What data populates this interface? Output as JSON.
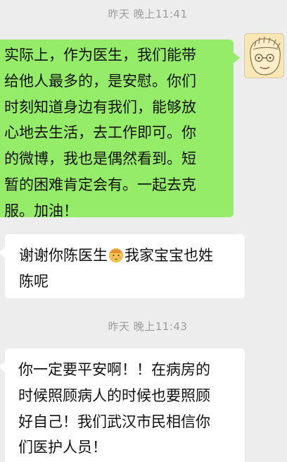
{
  "chat": {
    "timestamps": [
      "昨天 晚上11:41",
      "昨天 晚上11:43"
    ],
    "messages": [
      {
        "sender": "self",
        "lines": [
          "实际上，作为医生，我们能带",
          "给他人最多的，是安慰。你们",
          "时刻知道身边有我们，能够放",
          "心地去生活，去工作即可。你",
          "的微博，我也是偶然看到。短",
          "暂的困难肯定会有。一起去克",
          "服。加油！"
        ]
      },
      {
        "sender": "other",
        "line1_before_emoji": "谢谢你陈医生",
        "emoji": "shy-face-emoji",
        "line1_after_emoji": "我家宝宝也姓",
        "line2": "陈呢"
      },
      {
        "sender": "other",
        "lines": [
          "你一定要平安啊！！在病房的",
          "时候照顾病人的时候也要照顾",
          "好自己！我们武汉市民相信你",
          "们医护人员！"
        ]
      }
    ]
  },
  "colors": {
    "background": "#ededed",
    "self_bubble": "#95ec69",
    "other_bubble": "#ffffff",
    "timestamp": "#9b9b9b"
  }
}
